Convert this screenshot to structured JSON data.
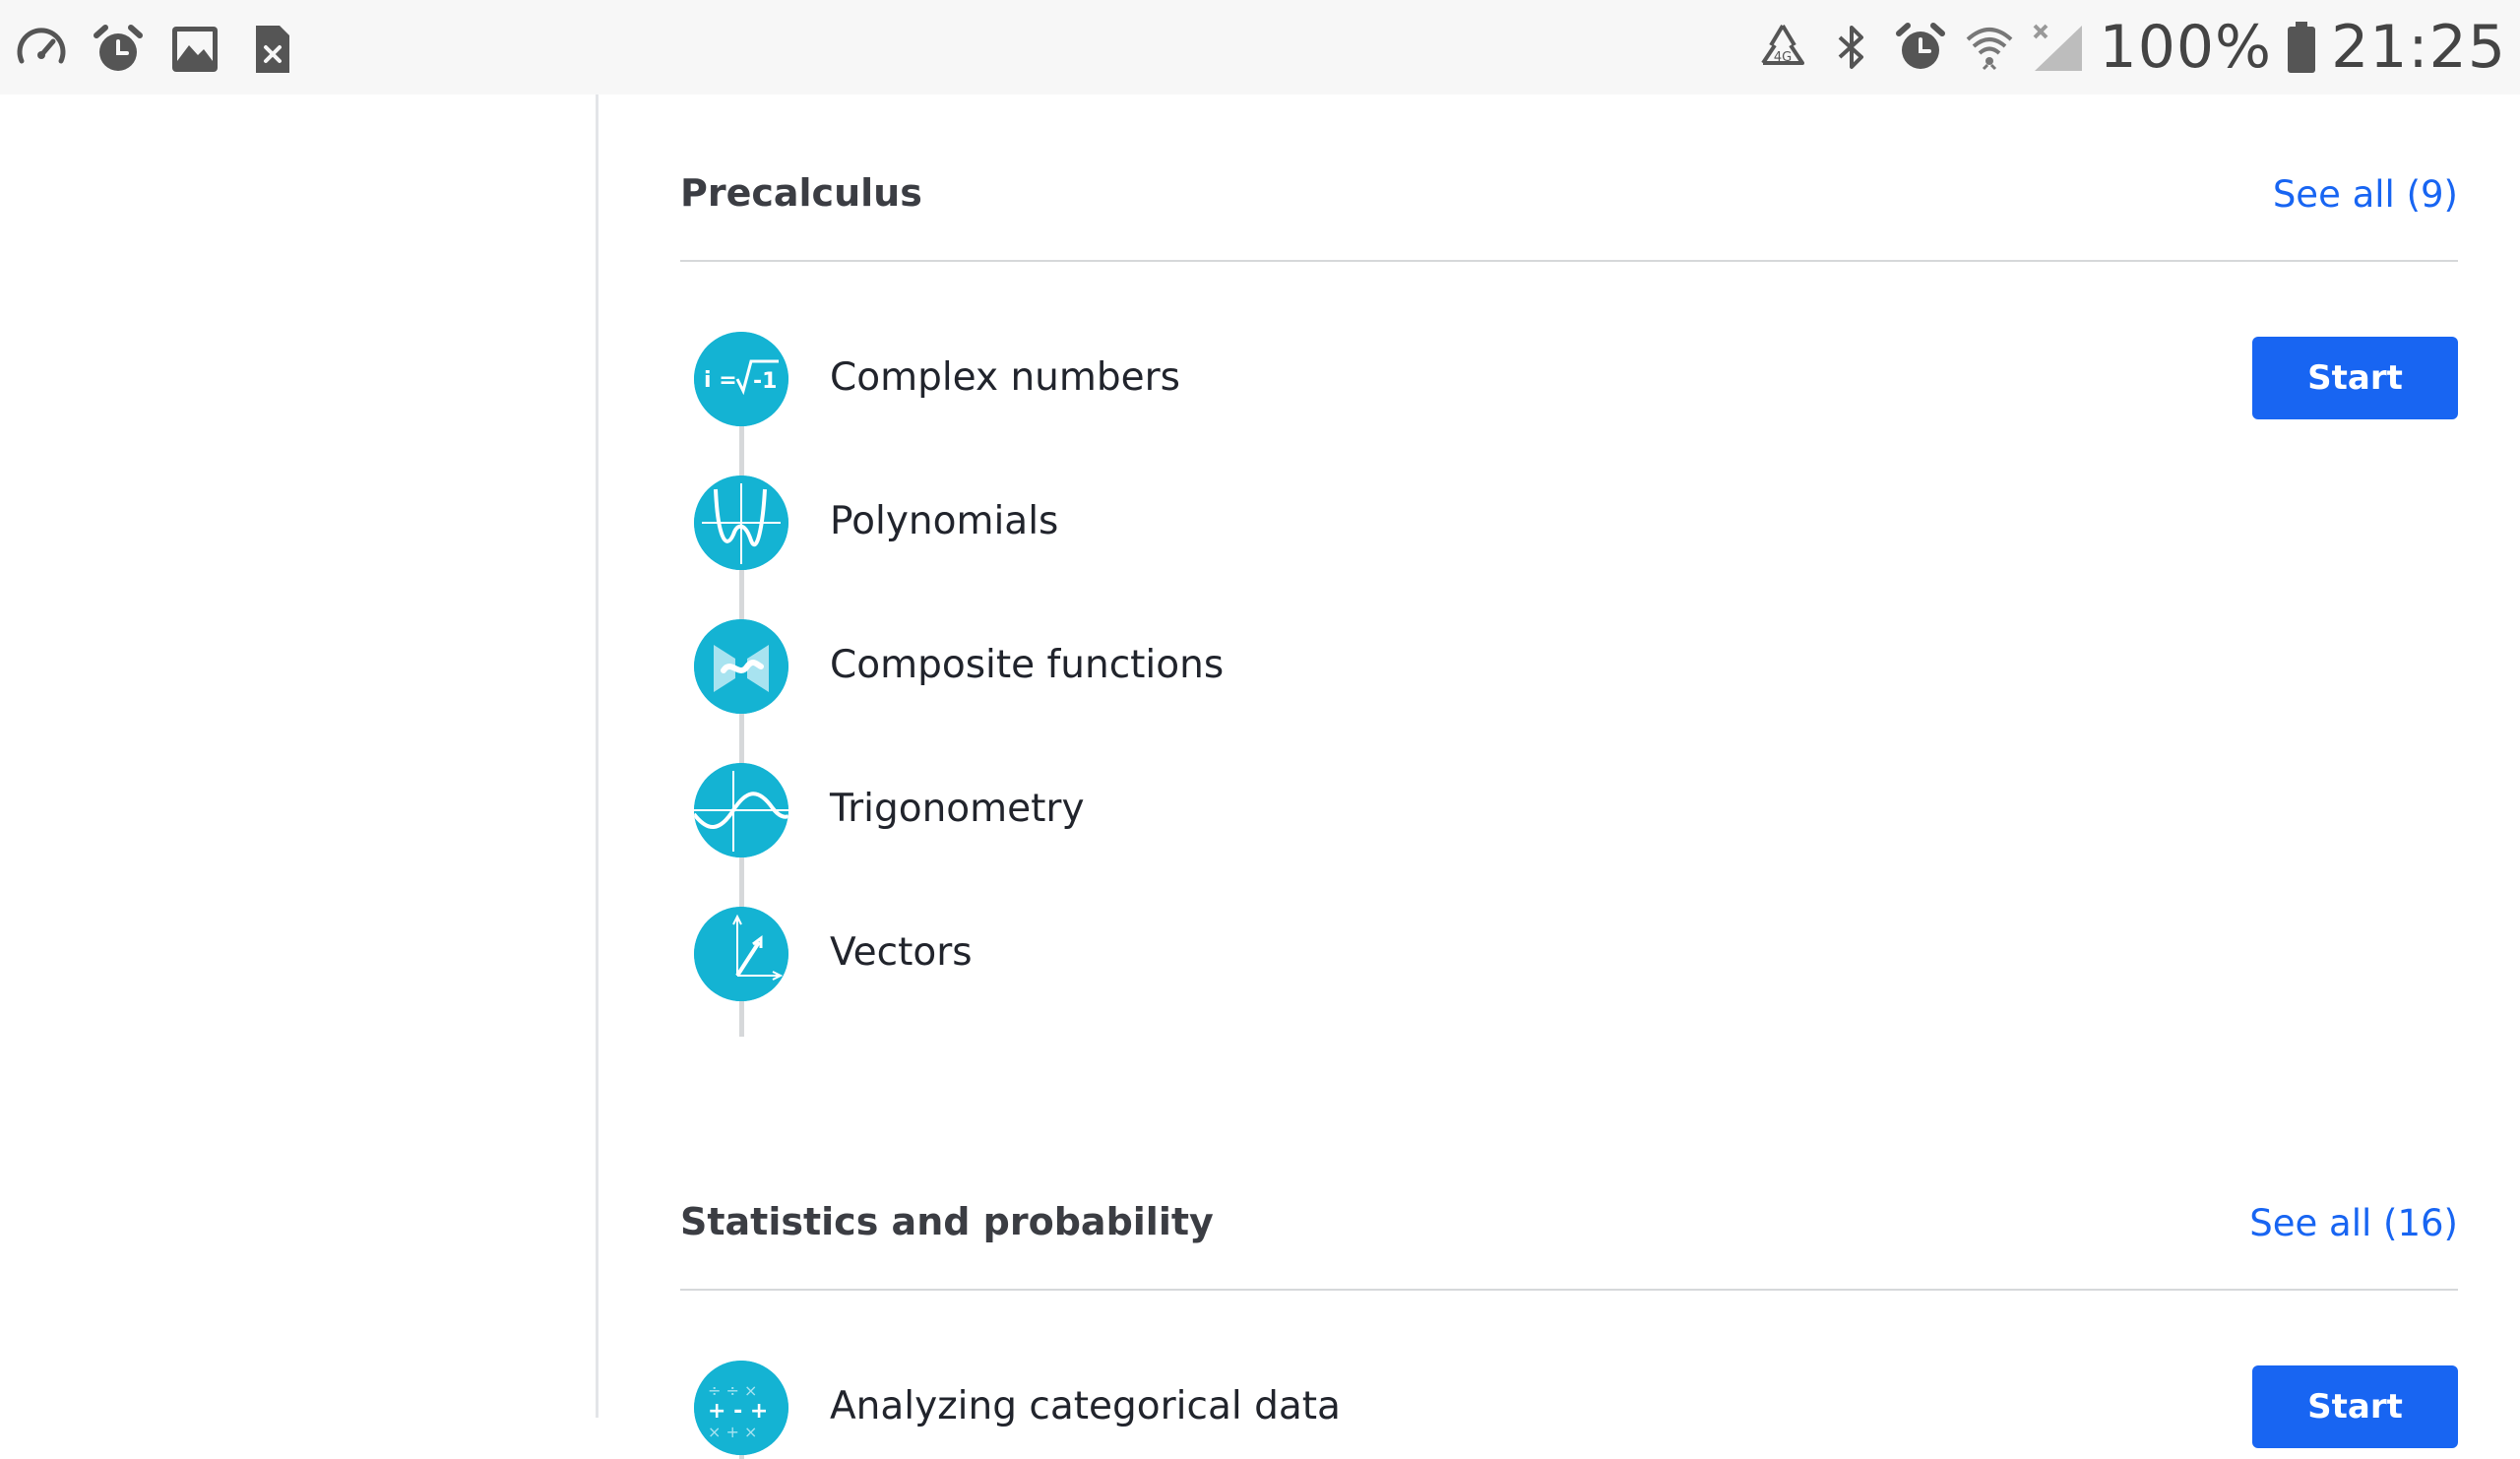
{
  "status_bar": {
    "left_icons": [
      "speedometer-icon",
      "alarm-icon",
      "image-icon",
      "sim-error-icon"
    ],
    "right_icons": [
      "recycle-icon",
      "bluetooth-icon",
      "alarm-icon",
      "wifi-icon",
      "signal-icon"
    ],
    "battery": "100%",
    "time": "21:25"
  },
  "sections": [
    {
      "title": "Precalculus",
      "see_all": "See all (9)",
      "items": [
        {
          "label": "Complex numbers",
          "icon": "complex-numbers-icon",
          "action": "Start"
        },
        {
          "label": "Polynomials",
          "icon": "polynomials-icon"
        },
        {
          "label": "Composite functions",
          "icon": "composite-functions-icon"
        },
        {
          "label": "Trigonometry",
          "icon": "trigonometry-icon"
        },
        {
          "label": "Vectors",
          "icon": "vectors-icon"
        }
      ]
    },
    {
      "title": "Statistics and probability",
      "see_all": "See all (16)",
      "items": [
        {
          "label": "Analyzing categorical data",
          "icon": "categorical-data-icon",
          "action": "Start"
        }
      ]
    }
  ],
  "colors": {
    "accent": "#1865f2",
    "icon_bg": "#14b3d3",
    "divider": "#d6d8da"
  }
}
